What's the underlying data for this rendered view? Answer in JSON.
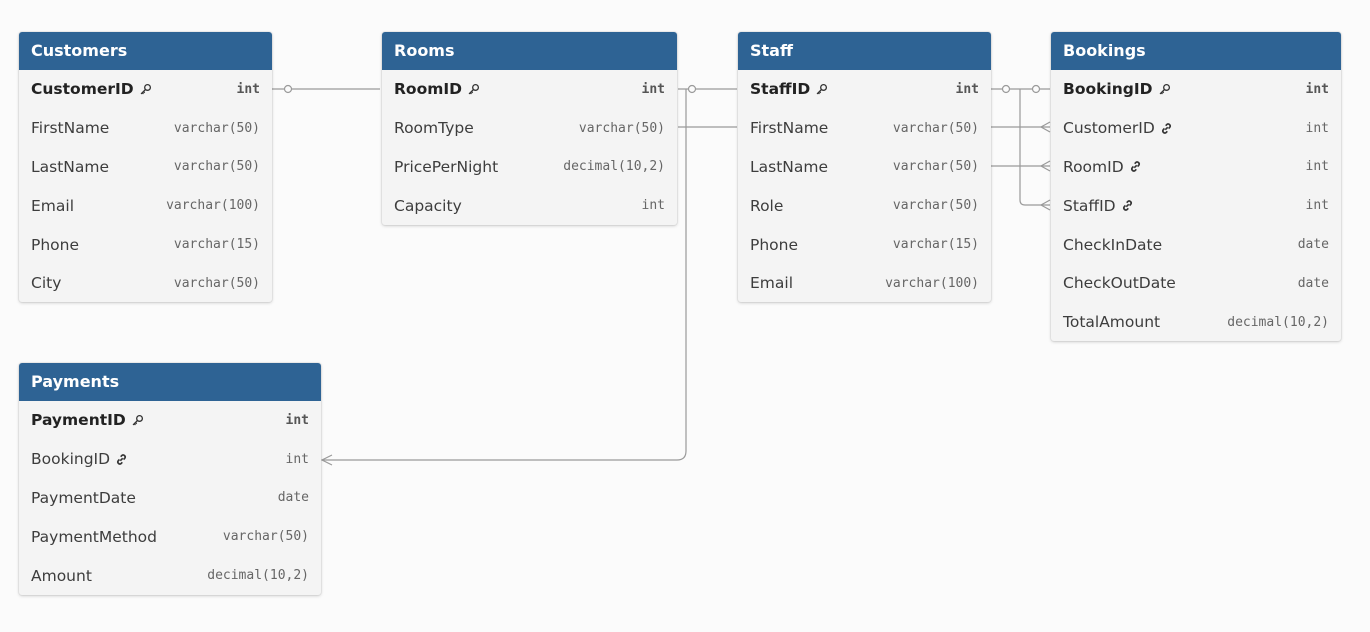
{
  "colors": {
    "header_bg": "#2e6394",
    "header_text": "#ffffff",
    "table_bg": "#f4f4f4",
    "connector": "#9a9a9a"
  },
  "tables": {
    "customers": {
      "title": "Customers",
      "columns": [
        {
          "name": "CustomerID",
          "type": "int",
          "key": "pk"
        },
        {
          "name": "FirstName",
          "type": "varchar(50)",
          "key": ""
        },
        {
          "name": "LastName",
          "type": "varchar(50)",
          "key": ""
        },
        {
          "name": "Email",
          "type": "varchar(100)",
          "key": ""
        },
        {
          "name": "Phone",
          "type": "varchar(15)",
          "key": ""
        },
        {
          "name": "City",
          "type": "varchar(50)",
          "key": ""
        }
      ]
    },
    "rooms": {
      "title": "Rooms",
      "columns": [
        {
          "name": "RoomID",
          "type": "int",
          "key": "pk"
        },
        {
          "name": "RoomType",
          "type": "varchar(50)",
          "key": ""
        },
        {
          "name": "PricePerNight",
          "type": "decimal(10,2)",
          "key": ""
        },
        {
          "name": "Capacity",
          "type": "int",
          "key": ""
        }
      ]
    },
    "staff": {
      "title": "Staff",
      "columns": [
        {
          "name": "StaffID",
          "type": "int",
          "key": "pk"
        },
        {
          "name": "FirstName",
          "type": "varchar(50)",
          "key": ""
        },
        {
          "name": "LastName",
          "type": "varchar(50)",
          "key": ""
        },
        {
          "name": "Role",
          "type": "varchar(50)",
          "key": ""
        },
        {
          "name": "Phone",
          "type": "varchar(15)",
          "key": ""
        },
        {
          "name": "Email",
          "type": "varchar(100)",
          "key": ""
        }
      ]
    },
    "bookings": {
      "title": "Bookings",
      "columns": [
        {
          "name": "BookingID",
          "type": "int",
          "key": "pk"
        },
        {
          "name": "CustomerID",
          "type": "int",
          "key": "fk"
        },
        {
          "name": "RoomID",
          "type": "int",
          "key": "fk"
        },
        {
          "name": "StaffID",
          "type": "int",
          "key": "fk"
        },
        {
          "name": "CheckInDate",
          "type": "date",
          "key": ""
        },
        {
          "name": "CheckOutDate",
          "type": "date",
          "key": ""
        },
        {
          "name": "TotalAmount",
          "type": "decimal(10,2)",
          "key": ""
        }
      ]
    },
    "payments": {
      "title": "Payments",
      "columns": [
        {
          "name": "PaymentID",
          "type": "int",
          "key": "pk"
        },
        {
          "name": "BookingID",
          "type": "int",
          "key": "fk"
        },
        {
          "name": "PaymentDate",
          "type": "date",
          "key": ""
        },
        {
          "name": "PaymentMethod",
          "type": "varchar(50)",
          "key": ""
        },
        {
          "name": "Amount",
          "type": "decimal(10,2)",
          "key": ""
        }
      ]
    }
  }
}
